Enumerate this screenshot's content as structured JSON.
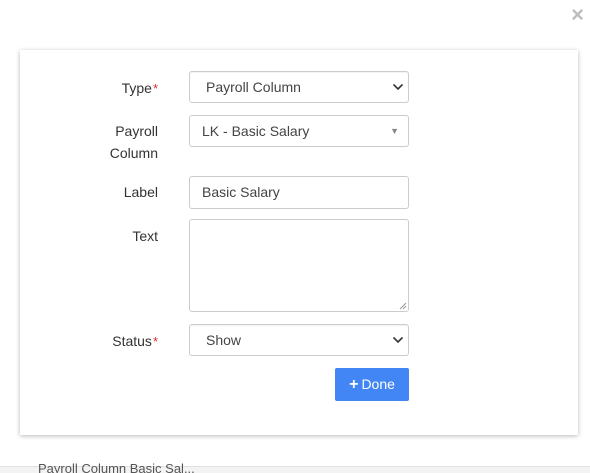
{
  "modal": {
    "close_glyph": "×",
    "type": {
      "label": "Type",
      "required": "*",
      "value": "Payroll Column"
    },
    "payroll_column": {
      "label": "Payroll Column",
      "value": "LK - Basic Salary"
    },
    "label_field": {
      "label": "Label",
      "value": "Basic Salary"
    },
    "text_field": {
      "label": "Text",
      "value": ""
    },
    "status": {
      "label": "Status",
      "required": "*",
      "value": "Show"
    },
    "done_button": {
      "icon": "+",
      "label": "Done"
    }
  },
  "background": {
    "partial_text": "Payroll Column Basic Sal..."
  }
}
